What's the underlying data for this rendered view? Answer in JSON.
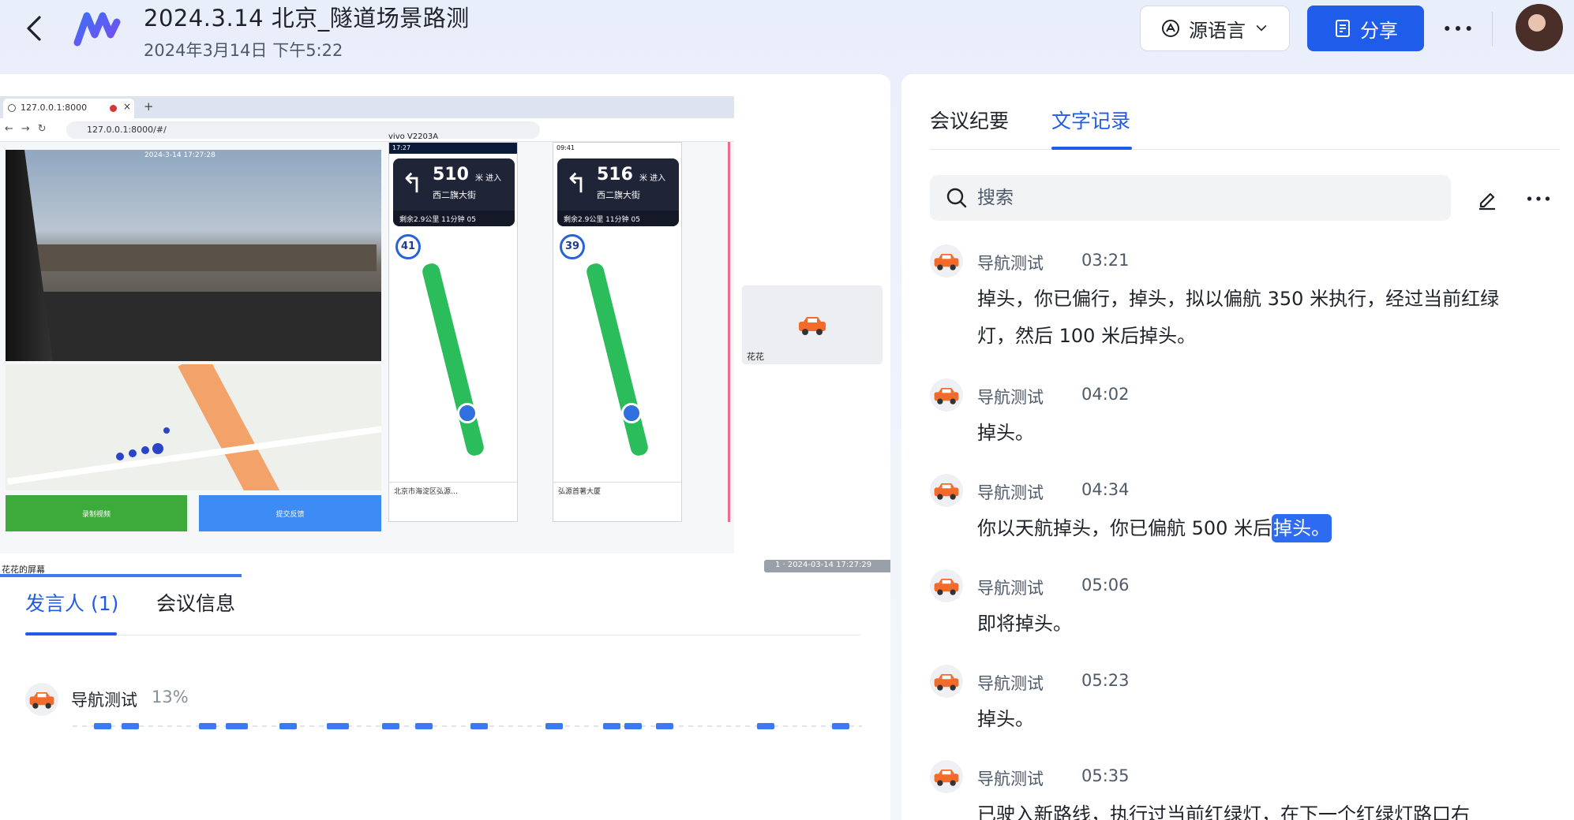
{
  "header": {
    "title": "2024.3.14 北京_隧道场景路测",
    "subtitle": "2024年3月14日 下午5:22",
    "lang_label": "源语言",
    "share_label": "分享"
  },
  "screen": {
    "browser_tab_title": "127.0.0.1:8000",
    "browser_url": "127.0.0.1:8000/#/",
    "dashcam_timestamp": "2024-3-14 17:27:28",
    "phone_label": "vivo V2203A",
    "phone1": {
      "time": "17:27",
      "distance": "510",
      "unit": "米 进入",
      "street": "西二旗大街",
      "stats": "剩余2.9公里    11分钟    05",
      "speed": "41",
      "bottom": "北京市海淀区弘源…"
    },
    "phone2": {
      "time": "09:41",
      "distance": "516",
      "unit": "米 进入",
      "street": "西二旗大街",
      "stats": "剩余2.9公里    11分钟    05",
      "speed": "39",
      "bottom": "弘源首著大厦"
    },
    "btn_green_label": "录制视频",
    "btn_blue_label": "提交反馈",
    "tile_name": "花花",
    "screen_caption": "花花的屏幕",
    "overlay_timestamp": "1 · 2024-03-14 17:27:29"
  },
  "left_tabs": {
    "speakers": "发言人 (1)",
    "info": "会议信息"
  },
  "speaker": {
    "name": "导航测试",
    "percent": "13%",
    "segments": [
      {
        "start": 0.027,
        "len": 0.022
      },
      {
        "start": 0.062,
        "len": 0.022
      },
      {
        "start": 0.16,
        "len": 0.022
      },
      {
        "start": 0.194,
        "len": 0.028
      },
      {
        "start": 0.262,
        "len": 0.022
      },
      {
        "start": 0.322,
        "len": 0.028
      },
      {
        "start": 0.392,
        "len": 0.022
      },
      {
        "start": 0.434,
        "len": 0.022
      },
      {
        "start": 0.504,
        "len": 0.022
      },
      {
        "start": 0.599,
        "len": 0.022
      },
      {
        "start": 0.672,
        "len": 0.022
      },
      {
        "start": 0.699,
        "len": 0.022
      },
      {
        "start": 0.739,
        "len": 0.022
      },
      {
        "start": 0.867,
        "len": 0.022
      },
      {
        "start": 0.962,
        "len": 0.022
      }
    ]
  },
  "right_tabs": {
    "minutes": "会议纪要",
    "transcript": "文字记录"
  },
  "search": {
    "placeholder": "搜索"
  },
  "transcript": [
    {
      "speaker": "导航测试",
      "time": "03:21",
      "text": "掉头，你已偏行，掉头，拟以偏航 350 米执行，经过当前红绿灯，然后 100 米后掉头。",
      "highlight": ""
    },
    {
      "speaker": "导航测试",
      "time": "04:02",
      "text": "掉头。",
      "highlight": ""
    },
    {
      "speaker": "导航测试",
      "time": "04:34",
      "text": "你以天航掉头，你已偏航 500 米后",
      "highlight": "掉头。"
    },
    {
      "speaker": "导航测试",
      "time": "05:06",
      "text": "即将掉头。",
      "highlight": ""
    },
    {
      "speaker": "导航测试",
      "time": "05:23",
      "text": "掉头。",
      "highlight": ""
    },
    {
      "speaker": "导航测试",
      "time": "05:35",
      "text": "已驶入新路线，执行过当前红绿灯，在下一个红绿灯路口右",
      "highlight": ""
    }
  ],
  "colors": {
    "accent": "#1f5ce9",
    "speaker_segment": "#3c79f2",
    "highlight": "#2d6cf0"
  },
  "icons": {
    "back": "chevron-left-icon",
    "lang": "translate-icon",
    "share": "share-doc-icon",
    "more": "more-dots-icon",
    "search": "search-icon",
    "edit": "pen-icon",
    "avatar": "orange-car-icon"
  }
}
